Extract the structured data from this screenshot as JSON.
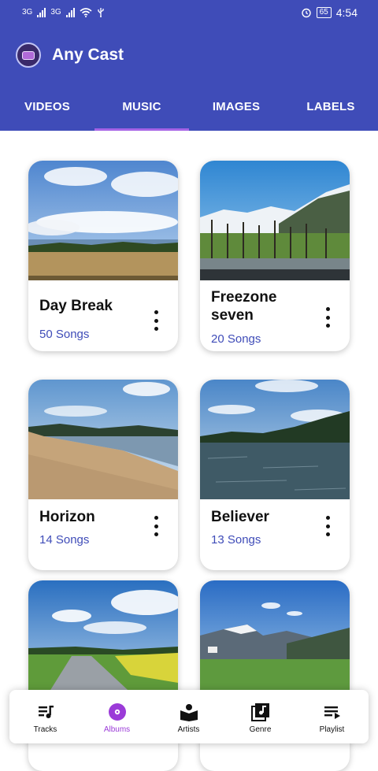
{
  "status_bar": {
    "network_1": "3G",
    "network_2": "3G",
    "battery": "65",
    "time": "4:54"
  },
  "app": {
    "title": "Any Cast"
  },
  "tabs": [
    {
      "label": "VIDEOS"
    },
    {
      "label": "MUSIC",
      "active": true
    },
    {
      "label": "IMAGES"
    },
    {
      "label": "LABELS"
    }
  ],
  "albums": [
    {
      "title": "Day Break",
      "count": "50 Songs"
    },
    {
      "title": "Freezone seven",
      "count": "20 Songs"
    },
    {
      "title": "Horizon",
      "count": "14 Songs"
    },
    {
      "title": "Believer",
      "count": "13 Songs"
    }
  ],
  "bottom_nav": [
    {
      "label": "Tracks",
      "icon": "tracks-icon"
    },
    {
      "label": "Albums",
      "icon": "album-icon",
      "active": true
    },
    {
      "label": "Artists",
      "icon": "artist-icon"
    },
    {
      "label": "Genre",
      "icon": "genre-icon"
    },
    {
      "label": "Playlist",
      "icon": "playlist-icon"
    }
  ],
  "colors": {
    "primary": "#3f4cb8",
    "accent": "#9b3bd8",
    "indicator": "#a563e6",
    "count_text": "#3f4cb8"
  }
}
